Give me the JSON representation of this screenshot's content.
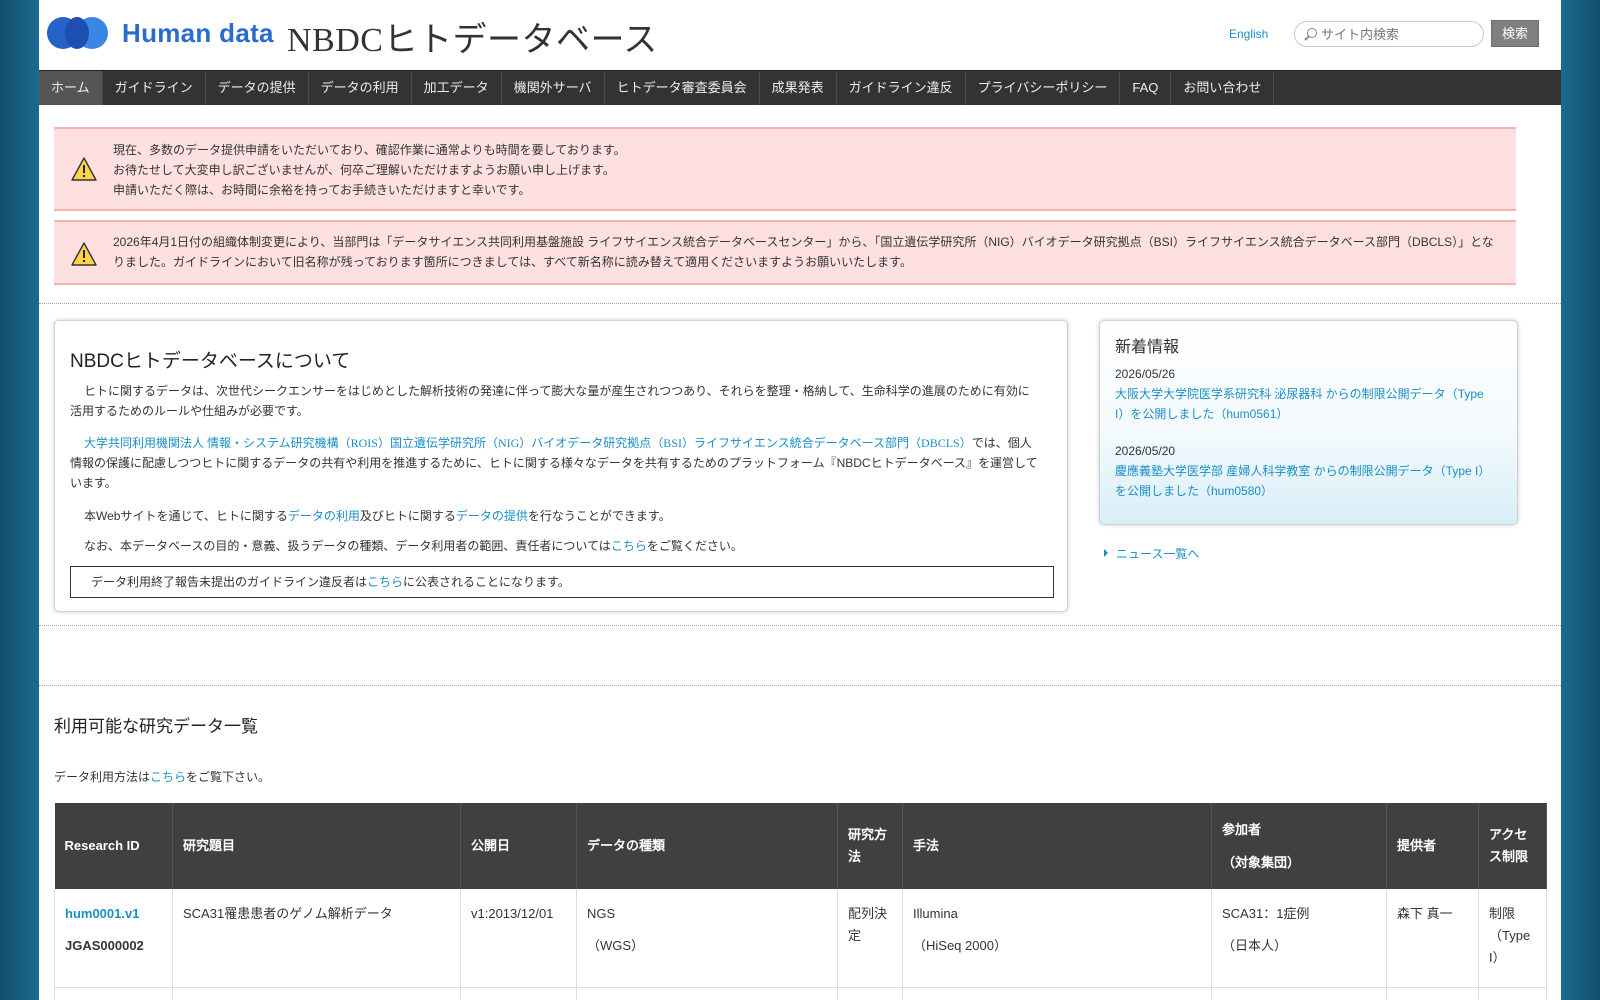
{
  "header": {
    "logo_text": "Human data",
    "site_title": "NBDCヒトデータベース",
    "lang_link": "English",
    "search_placeholder": "サイト内検索",
    "search_button": "検索"
  },
  "nav": {
    "items": [
      "ホーム",
      "ガイドライン",
      "データの提供",
      "データの利用",
      "加工データ",
      "機関外サーバ",
      "ヒトデータ審査委員会",
      "成果発表",
      "ガイドライン違反",
      "プライバシーポリシー",
      "FAQ",
      "お問い合わせ"
    ],
    "active": "ホーム"
  },
  "notices": [
    {
      "lines": [
        "現在、多数のデータ提供申請をいただいており、確認作業に通常よりも時間を要しております。",
        "お待たせして大変申し訳ございませんが、何卒ご理解いただけますようお願い申し上げます。",
        "申請いただく際は、お時間に余裕を持ってお手続きいただけますと幸いです。"
      ]
    },
    {
      "lines": [
        "2026年4月1日付の組織体制変更により、当部門は「データサイエンス共同利用基盤施設 ライフサイエンス統合データベースセンター」から、「国立遺伝学研究所（NIG）バイオデータ研究拠点（BSI）ライフサイエンス統合データベース部門（DBCLS）」となりました。ガイドラインにおいて旧名称が残っております箇所につきましては、すべて新名称に読み替えて適用くださいますようお願いいたします。"
      ]
    }
  ],
  "about": {
    "title": "NBDCヒトデータベースについて",
    "p1": "ヒトに関するデータは、次世代シークエンサーをはじめとした解析技術の発達に伴って膨大な量が産生されつつあり、それらを整理・格納して、生命科学の進展のために有効に活用するためのルールや仕組みが必要です。",
    "p2_link": "大学共同利用機関法人 情報・システム研究機構（ROIS）国立遺伝学研究所（NIG）バイオデータ研究拠点（BSI）ライフサイエンス統合データベース部門（DBCLS）",
    "p2_rest": "では、個人情報の保護に配慮しつつヒトに関するデータの共有や利用を推進するために、ヒトに関する様々なデータを共有するためのプラットフォーム『NBDCヒトデータベース』を運営しています。",
    "p3_a": "本Webサイトを通じて、ヒトに関する",
    "p3_link1": "データの利用",
    "p3_b": "及びヒトに関する",
    "p3_link2": "データの提供",
    "p3_c": "を行なうことができます。",
    "p4_a": "なお、本データベースの目的・意義、扱うデータの種類、データ利用者の範囲、責任者については",
    "p4_link": "こちら",
    "p4_b": "をご覧ください。",
    "box_a": "データ利用終了報告未提出のガイドライン違反者は",
    "box_link": "こちら",
    "box_b": "に公表されることになります。"
  },
  "news": {
    "title": "新着情報",
    "items": [
      {
        "date": "2026/05/26",
        "title": "大阪大学大学院医学系研究科 泌尿器科 からの制限公開データ（Type I）を公開しました（hum0561）"
      },
      {
        "date": "2026/05/20",
        "title": "慶應義塾大学医学部 産婦人科学教室 からの制限公開データ（Type I）を公開しました（hum0580）"
      }
    ],
    "more": "ニュース一覧へ"
  },
  "data_list": {
    "heading": "利用可能な研究データ一覧",
    "note_a": "データ利用方法は",
    "note_link": "こちら",
    "note_b": "をご覧下さい。",
    "columns": [
      "Research ID",
      "研究題目",
      "公開日",
      "データの種類",
      "研究方法",
      "手法",
      "参加者",
      "（対象集団）",
      "提供者",
      "アクセス制限"
    ],
    "rows": [
      {
        "research_id": "hum0001.v1",
        "jgas": "JGAS000002",
        "title": "SCA31罹患患者のゲノム解析データ",
        "date": "v1:2013/12/01",
        "data_type": "NGS",
        "data_type_sub": "（WGS）",
        "method": "配列決定",
        "technique": "Illumina",
        "technique_sub": "（HiSeq 2000）",
        "participants": "SCA31：1症例",
        "participants_sub": "（日本人）",
        "provider": "森下 真一",
        "access": "制限（Type I）"
      }
    ]
  },
  "colors": {
    "link": "#1a8fc6",
    "nav_bg": "#333333",
    "notice_bg": "#ffe0e0",
    "table_header_bg": "#404040",
    "page_bg": "#1d6a90",
    "logo_blue": "#2a6ccc"
  },
  "icons": [
    "warning-icon",
    "search-icon",
    "arrow-right-icon",
    "logo-icon"
  ]
}
